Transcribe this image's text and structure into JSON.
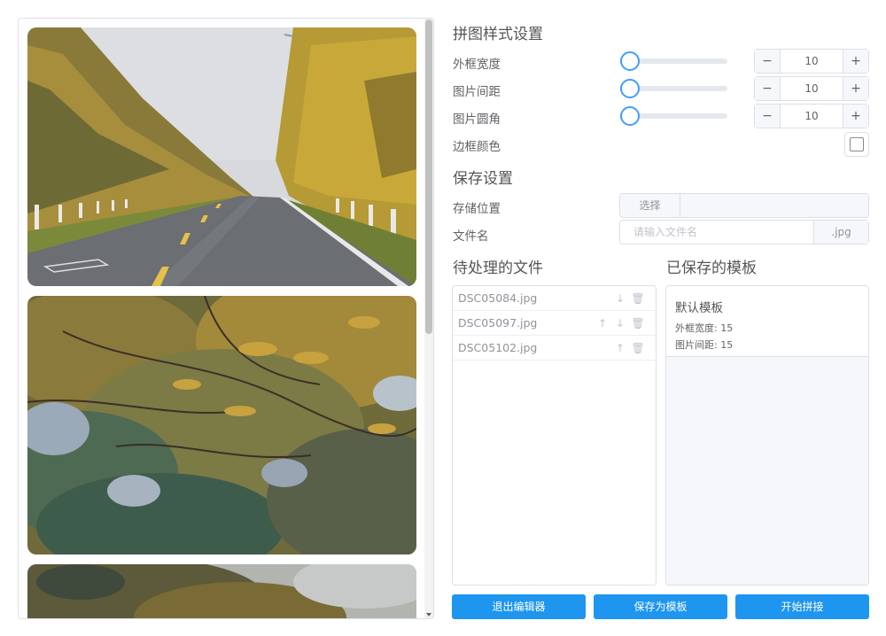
{
  "style_settings": {
    "title": "拼图样式设置",
    "frame_width": {
      "label": "外框宽度",
      "value": "10",
      "slider_fraction": 0.02
    },
    "image_spacing": {
      "label": "图片间距",
      "value": "10",
      "slider_fraction": 0.02
    },
    "image_radius": {
      "label": "图片圆角",
      "value": "10",
      "slider_fraction": 0.02
    },
    "border_color": {
      "label": "边框颜色",
      "value": "#ffffff"
    },
    "minus_symbol": "−",
    "plus_symbol": "+"
  },
  "save_settings": {
    "title": "保存设置",
    "storage_label": "存储位置",
    "choose_button": "选择",
    "filename_label": "文件名",
    "filename_placeholder": "请输入文件名",
    "extension": ".jpg"
  },
  "pending_files": {
    "title": "待处理的文件",
    "files": [
      {
        "name": "DSC05084.jpg",
        "up": false,
        "down": true
      },
      {
        "name": "DSC05097.jpg",
        "up": true,
        "down": true
      },
      {
        "name": "DSC05102.jpg",
        "up": true,
        "down": false
      }
    ],
    "icons": {
      "up": "arrow-up-icon",
      "down": "arrow-down-icon",
      "delete": "trash-icon"
    }
  },
  "saved_templates": {
    "title": "已保存的模板",
    "items": [
      {
        "name": "默认模板",
        "line1": "外框宽度: 15",
        "line2": "图片间距: 15"
      }
    ]
  },
  "actions": {
    "exit": "退出编辑器",
    "save_template": "保存为模板",
    "start": "开始拼接"
  },
  "colors": {
    "accent": "#409eff",
    "button": "#1e96f0",
    "border": "#dcdfe6"
  }
}
